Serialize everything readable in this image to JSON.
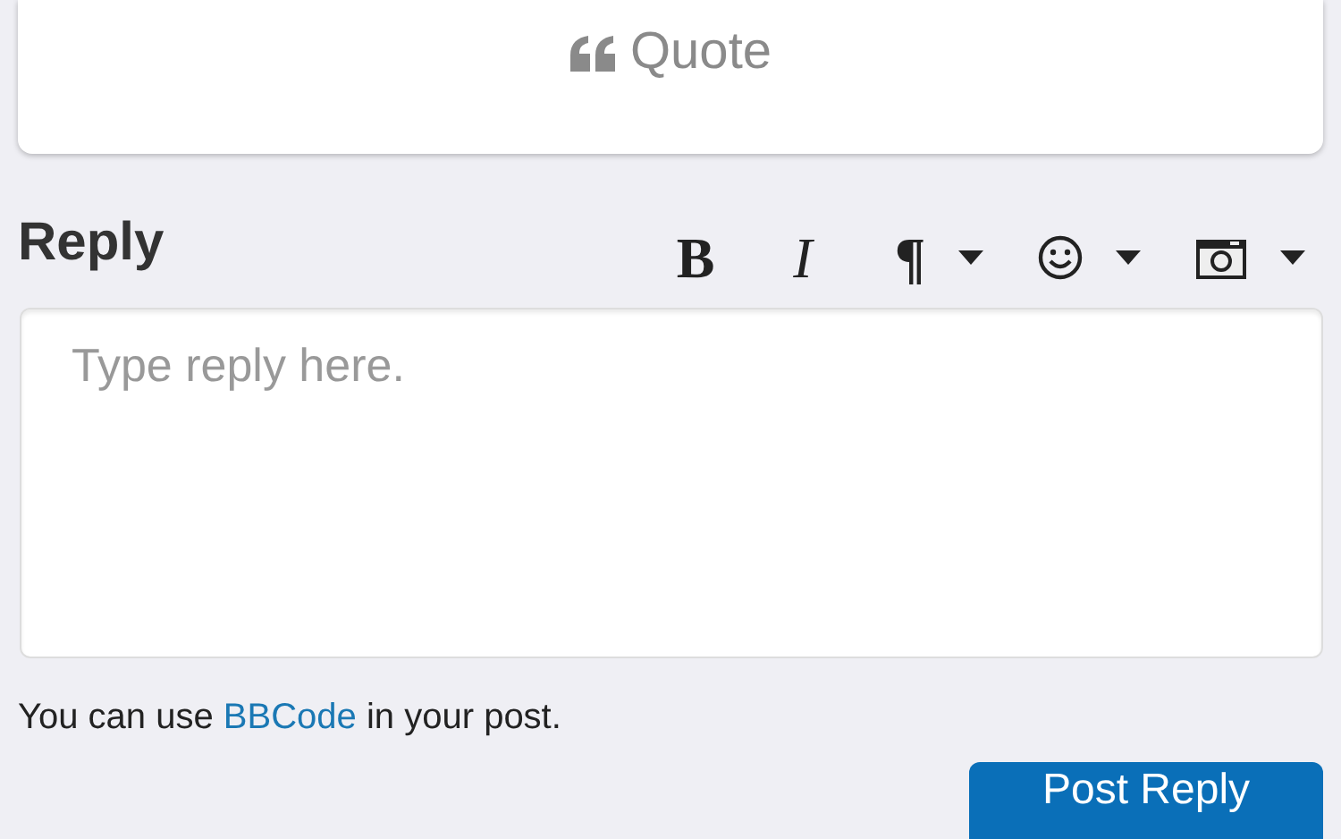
{
  "quote_button": {
    "label": "Quote"
  },
  "reply": {
    "heading": "Reply",
    "toolbar": [
      {
        "kind": "bold",
        "label": "B"
      },
      {
        "kind": "italic",
        "label": "I"
      },
      {
        "kind": "paragraph",
        "label": "¶",
        "dropdown": true
      },
      {
        "kind": "smiley",
        "dropdown": true
      },
      {
        "kind": "camera",
        "dropdown": true
      }
    ],
    "placeholder": "Type reply here.",
    "help": {
      "before": "You can use",
      "link": "BBCode",
      "after": "in your post."
    },
    "submit": "Post Reply"
  }
}
